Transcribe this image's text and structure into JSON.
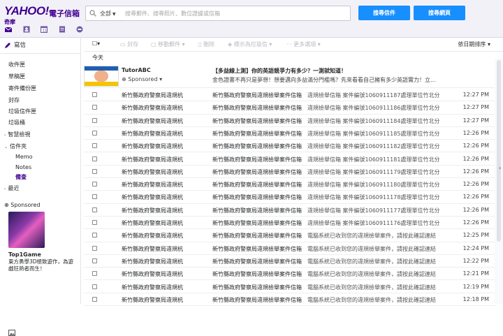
{
  "header": {
    "logo_text": "YAHOO!",
    "logo_sub": "奇摩",
    "logo_mail": "電子信箱",
    "search_scope": "全部",
    "search_placeholder": "搜尋郵件、搜尋照片、數位證據或信箱",
    "search_mail_button": "搜尋信件",
    "search_web_button": "搜尋網頁"
  },
  "toolbar": {
    "select_all": "☐▾",
    "archive": "封存",
    "move": "移動郵件 ▾",
    "delete": "刪除",
    "spam": "標示為垃圾信 ▾",
    "more": "更多選項 ▾",
    "sort": "依日期排序 ▾"
  },
  "sidebar": {
    "compose": "寫信",
    "folders": [
      "收件匣",
      "草稿匣",
      "寄件備份匣",
      "封存",
      "垃圾信件匣",
      "垃圾桶"
    ],
    "smart_views": "智慧檢視",
    "folders_group": "信件夾",
    "sub_folders": [
      "Memo",
      "Notes",
      "備查"
    ],
    "recent": "最近",
    "sponsored_label": "Sponsored",
    "ad_title": "Top1Game",
    "ad_text": "東方勇學3D極致遊作，為遊戲狂熱者而生！"
  },
  "list": {
    "today_label": "今天",
    "sponsored_row": {
      "sender": "TutorABC",
      "sponsored": "Sponsored ▾",
      "subject": "【多益線上測】你的英語競爭力有多少？一測就知道！",
      "body": "金色證書不再只是夢想！想要邁向多益滿分門檻嗎？先來看看自己擁有多少英語實力！立..."
    },
    "rows": [
      {
        "from": "新竹縣政府警察局違規杭",
        "subj": "新竹縣政府警察局違規檢舉案件信箱",
        "prev": "違規檢舉信箱 案件編號1060911187處理單位竹北分",
        "time": "12:27 PM"
      },
      {
        "from": "新竹縣政府警察局違規杭",
        "subj": "新竹縣政府警察局違規檢舉案件信箱",
        "prev": "違規檢舉信箱 案件編號1060911186處理單位竹北分",
        "time": "12:27 PM"
      },
      {
        "from": "新竹縣政府警察局違規杭",
        "subj": "新竹縣政府警察局違規檢舉案件信箱",
        "prev": "違規檢舉信箱 案件編號1060911184處理單位竹北分",
        "time": "12:27 PM"
      },
      {
        "from": "新竹縣政府警察局違規杭",
        "subj": "新竹縣政府警察局違規檢舉案件信箱",
        "prev": "違規檢舉信箱 案件編號1060911185處理單位竹北分",
        "time": "12:26 PM"
      },
      {
        "from": "新竹縣政府警察局違規杭",
        "subj": "新竹縣政府警察局違規檢舉案件信箱",
        "prev": "違規檢舉信箱 案件編號1060911182處理單位竹北分",
        "time": "12:26 PM"
      },
      {
        "from": "新竹縣政府警察局違規杭",
        "subj": "新竹縣政府警察局違規檢舉案件信箱",
        "prev": "違規檢舉信箱 案件編號1060911181處理單位竹北分",
        "time": "12:26 PM"
      },
      {
        "from": "新竹縣政府警察局違規杭",
        "subj": "新竹縣政府警察局違規檢舉案件信箱",
        "prev": "違規檢舉信箱 案件編號1060911179處理單位竹北分",
        "time": "12:26 PM"
      },
      {
        "from": "新竹縣政府警察局違規杭",
        "subj": "新竹縣政府警察局違規檢舉案件信箱",
        "prev": "違規檢舉信箱 案件編號1060911180處理單位竹北分",
        "time": "12:26 PM"
      },
      {
        "from": "新竹縣政府警察局違規杭",
        "subj": "新竹縣政府警察局違規檢舉案件信箱",
        "prev": "違規檢舉信箱 案件編號1060911178處理單位竹北分",
        "time": "12:26 PM"
      },
      {
        "from": "新竹縣政府警察局違規杭",
        "subj": "新竹縣政府警察局違規檢舉案件信箱",
        "prev": "違規檢舉信箱 案件編號1060911177處理單位竹北分",
        "time": "12:26 PM"
      },
      {
        "from": "新竹縣政府警察局違規杭",
        "subj": "新竹縣政府警察局違規檢舉案件信箱",
        "prev": "違規檢舉信箱 案件編號1060911176處理單位竹北分",
        "time": "12:26 PM"
      },
      {
        "from": "新竹縣政府警察局違規杭",
        "subj": "新竹縣政府警察局違規檢舉案件信箱",
        "prev": "電腦系統已收到您的違規檢舉案件，請按此確認連結",
        "time": "12:25 PM"
      },
      {
        "from": "新竹縣政府警察局違規杭",
        "subj": "新竹縣政府警察局違規檢舉案件信箱",
        "prev": "電腦系統已收到您的違規檢舉案件，請按此確認連結",
        "time": "12:24 PM"
      },
      {
        "from": "新竹縣政府警察局違規杭",
        "subj": "新竹縣政府警察局違規檢舉案件信箱",
        "prev": "電腦系統已收到您的違規檢舉案件，請按此確認連結",
        "time": "12:22 PM"
      },
      {
        "from": "新竹縣政府警察局違規杭",
        "subj": "新竹縣政府警察局違規檢舉案件信箱",
        "prev": "電腦系統已收到您的違規檢舉案件，請按此確認連結",
        "time": "12:21 PM"
      },
      {
        "from": "新竹縣政府警察局違規杭",
        "subj": "新竹縣政府警察局違規檢舉案件信箱",
        "prev": "電腦系統已收到您的違規檢舉案件，請按此確認連結",
        "time": "12:19 PM"
      },
      {
        "from": "新竹縣政府警察局違規杭",
        "subj": "新竹縣政府警察局違規檢舉案件信箱",
        "prev": "電腦系統已收到您的違規檢舉案件，請按此確認連結",
        "time": "12:18 PM"
      }
    ]
  },
  "colors": {
    "brand": "#400090",
    "accent": "#188fff"
  }
}
